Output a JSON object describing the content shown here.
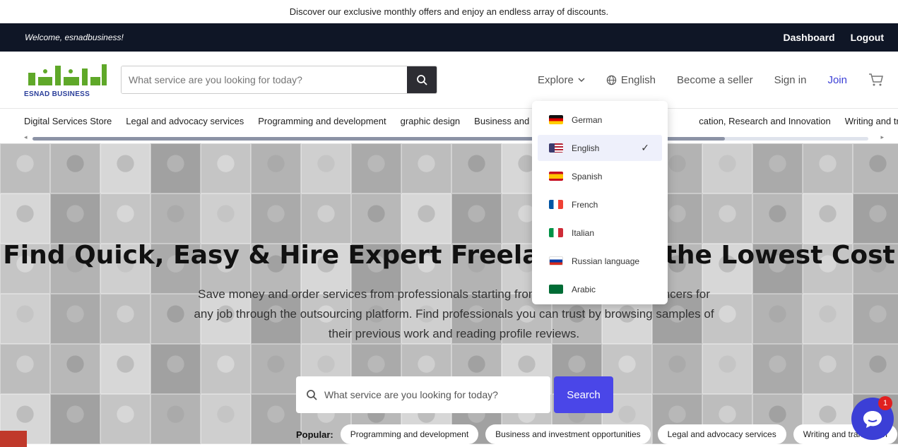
{
  "promo": {
    "text": "Discover our exclusive monthly offers and enjoy an endless array of discounts."
  },
  "topbar": {
    "welcome": "Welcome, esnadbusiness!",
    "dashboard": "Dashboard",
    "logout": "Logout"
  },
  "header": {
    "logo_text": "ESNAD BUSINESS",
    "search_placeholder": "What service are you looking for today?",
    "explore": "Explore",
    "language": "English",
    "become_seller": "Become a seller",
    "sign_in": "Sign in",
    "join": "Join",
    "accent_color": "#3b3fd6"
  },
  "categories": [
    "Digital Services Store",
    "Legal and advocacy services",
    "Programming and development",
    "graphic design",
    "Business and",
    "cation, Research and Innovation",
    "Writing and transla"
  ],
  "hero": {
    "title": "Find Quick, Easy & Hire Expert Freelancers at the Lowest Cost",
    "subtitle": "Save money and order services from professionals starting from $5. Hire the best freelancers for any job through the outsourcing platform. Find professionals you can trust by browsing samples of their previous work and reading profile reviews.",
    "search_placeholder": "What service are you looking for today?",
    "search_button": "Search",
    "popular_label": "Popular:",
    "popular": [
      "Programming and development",
      "Business and investment opportunities",
      "Legal and advocacy services",
      "Writing and translation"
    ]
  },
  "language_menu": {
    "selected": "English",
    "items": [
      {
        "label": "German",
        "flag": "de-flag-icon"
      },
      {
        "label": "English",
        "flag": "us-flag-icon"
      },
      {
        "label": "Spanish",
        "flag": "es-flag-icon"
      },
      {
        "label": "French",
        "flag": "fr-flag-icon"
      },
      {
        "label": "Italian",
        "flag": "it-flag-icon"
      },
      {
        "label": "Russian language",
        "flag": "ru-flag-icon"
      },
      {
        "label": "Arabic",
        "flag": "sa-flag-icon"
      }
    ]
  },
  "chat": {
    "badge_count": "1"
  }
}
